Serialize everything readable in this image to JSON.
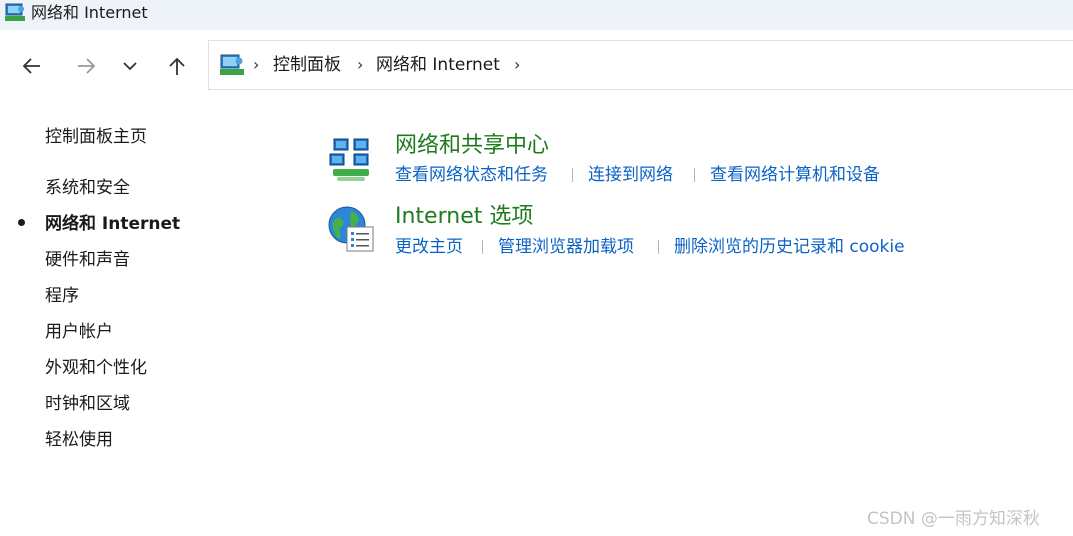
{
  "window": {
    "title": "网络和 Internet"
  },
  "nav": {
    "back_icon": "arrow-left-icon",
    "forward_icon": "arrow-right-icon",
    "recent_icon": "chevron-down-icon",
    "up_icon": "arrow-up-icon"
  },
  "address": {
    "crumbs": [
      "控制面板",
      "网络和 Internet"
    ],
    "separator": "›"
  },
  "sidebar": {
    "items": [
      {
        "label": "控制面板主页"
      },
      {
        "label": "系统和安全"
      },
      {
        "label": "网络和 Internet"
      },
      {
        "label": "硬件和声音"
      },
      {
        "label": "程序"
      },
      {
        "label": "用户帐户"
      },
      {
        "label": "外观和个性化"
      },
      {
        "label": "时钟和区域"
      },
      {
        "label": "轻松使用"
      }
    ]
  },
  "categories": [
    {
      "title": "网络和共享中心",
      "icon": "network-icon",
      "links": [
        "查看网络状态和任务",
        "连接到网络",
        "查看网络计算机和设备"
      ]
    },
    {
      "title": "Internet 选项",
      "icon": "globe-icon",
      "links": [
        "更改主页",
        "管理浏览器加载项",
        "删除浏览的历史记录和 cookie"
      ]
    }
  ],
  "watermark": "CSDN @一雨方知深秋",
  "colors": {
    "category_title": "#1e7b1e",
    "link": "#0b63c5",
    "titlebar_bg": "#eef3f9"
  }
}
